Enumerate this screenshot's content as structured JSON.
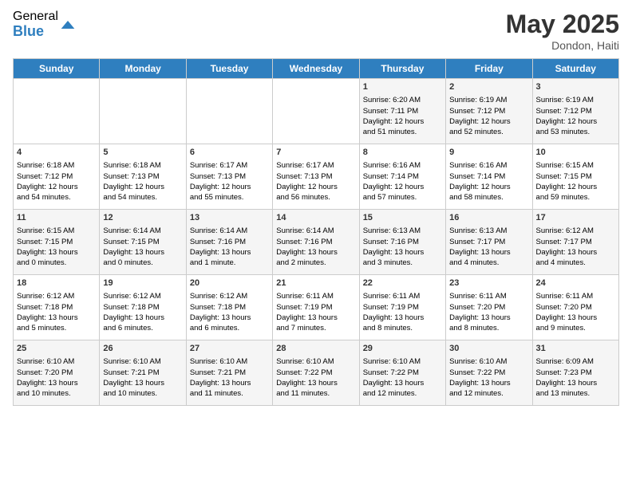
{
  "logo": {
    "general": "General",
    "blue": "Blue"
  },
  "title": "May 2025",
  "subtitle": "Dondon, Haiti",
  "days_header": [
    "Sunday",
    "Monday",
    "Tuesday",
    "Wednesday",
    "Thursday",
    "Friday",
    "Saturday"
  ],
  "weeks": [
    [
      {
        "day": "",
        "info": ""
      },
      {
        "day": "",
        "info": ""
      },
      {
        "day": "",
        "info": ""
      },
      {
        "day": "",
        "info": ""
      },
      {
        "day": "1",
        "info": "Sunrise: 6:20 AM\nSunset: 7:11 PM\nDaylight: 12 hours\nand 51 minutes."
      },
      {
        "day": "2",
        "info": "Sunrise: 6:19 AM\nSunset: 7:12 PM\nDaylight: 12 hours\nand 52 minutes."
      },
      {
        "day": "3",
        "info": "Sunrise: 6:19 AM\nSunset: 7:12 PM\nDaylight: 12 hours\nand 53 minutes."
      }
    ],
    [
      {
        "day": "4",
        "info": "Sunrise: 6:18 AM\nSunset: 7:12 PM\nDaylight: 12 hours\nand 54 minutes."
      },
      {
        "day": "5",
        "info": "Sunrise: 6:18 AM\nSunset: 7:13 PM\nDaylight: 12 hours\nand 54 minutes."
      },
      {
        "day": "6",
        "info": "Sunrise: 6:17 AM\nSunset: 7:13 PM\nDaylight: 12 hours\nand 55 minutes."
      },
      {
        "day": "7",
        "info": "Sunrise: 6:17 AM\nSunset: 7:13 PM\nDaylight: 12 hours\nand 56 minutes."
      },
      {
        "day": "8",
        "info": "Sunrise: 6:16 AM\nSunset: 7:14 PM\nDaylight: 12 hours\nand 57 minutes."
      },
      {
        "day": "9",
        "info": "Sunrise: 6:16 AM\nSunset: 7:14 PM\nDaylight: 12 hours\nand 58 minutes."
      },
      {
        "day": "10",
        "info": "Sunrise: 6:15 AM\nSunset: 7:15 PM\nDaylight: 12 hours\nand 59 minutes."
      }
    ],
    [
      {
        "day": "11",
        "info": "Sunrise: 6:15 AM\nSunset: 7:15 PM\nDaylight: 13 hours\nand 0 minutes."
      },
      {
        "day": "12",
        "info": "Sunrise: 6:14 AM\nSunset: 7:15 PM\nDaylight: 13 hours\nand 0 minutes."
      },
      {
        "day": "13",
        "info": "Sunrise: 6:14 AM\nSunset: 7:16 PM\nDaylight: 13 hours\nand 1 minute."
      },
      {
        "day": "14",
        "info": "Sunrise: 6:14 AM\nSunset: 7:16 PM\nDaylight: 13 hours\nand 2 minutes."
      },
      {
        "day": "15",
        "info": "Sunrise: 6:13 AM\nSunset: 7:16 PM\nDaylight: 13 hours\nand 3 minutes."
      },
      {
        "day": "16",
        "info": "Sunrise: 6:13 AM\nSunset: 7:17 PM\nDaylight: 13 hours\nand 4 minutes."
      },
      {
        "day": "17",
        "info": "Sunrise: 6:12 AM\nSunset: 7:17 PM\nDaylight: 13 hours\nand 4 minutes."
      }
    ],
    [
      {
        "day": "18",
        "info": "Sunrise: 6:12 AM\nSunset: 7:18 PM\nDaylight: 13 hours\nand 5 minutes."
      },
      {
        "day": "19",
        "info": "Sunrise: 6:12 AM\nSunset: 7:18 PM\nDaylight: 13 hours\nand 6 minutes."
      },
      {
        "day": "20",
        "info": "Sunrise: 6:12 AM\nSunset: 7:18 PM\nDaylight: 13 hours\nand 6 minutes."
      },
      {
        "day": "21",
        "info": "Sunrise: 6:11 AM\nSunset: 7:19 PM\nDaylight: 13 hours\nand 7 minutes."
      },
      {
        "day": "22",
        "info": "Sunrise: 6:11 AM\nSunset: 7:19 PM\nDaylight: 13 hours\nand 8 minutes."
      },
      {
        "day": "23",
        "info": "Sunrise: 6:11 AM\nSunset: 7:20 PM\nDaylight: 13 hours\nand 8 minutes."
      },
      {
        "day": "24",
        "info": "Sunrise: 6:11 AM\nSunset: 7:20 PM\nDaylight: 13 hours\nand 9 minutes."
      }
    ],
    [
      {
        "day": "25",
        "info": "Sunrise: 6:10 AM\nSunset: 7:20 PM\nDaylight: 13 hours\nand 10 minutes."
      },
      {
        "day": "26",
        "info": "Sunrise: 6:10 AM\nSunset: 7:21 PM\nDaylight: 13 hours\nand 10 minutes."
      },
      {
        "day": "27",
        "info": "Sunrise: 6:10 AM\nSunset: 7:21 PM\nDaylight: 13 hours\nand 11 minutes."
      },
      {
        "day": "28",
        "info": "Sunrise: 6:10 AM\nSunset: 7:22 PM\nDaylight: 13 hours\nand 11 minutes."
      },
      {
        "day": "29",
        "info": "Sunrise: 6:10 AM\nSunset: 7:22 PM\nDaylight: 13 hours\nand 12 minutes."
      },
      {
        "day": "30",
        "info": "Sunrise: 6:10 AM\nSunset: 7:22 PM\nDaylight: 13 hours\nand 12 minutes."
      },
      {
        "day": "31",
        "info": "Sunrise: 6:09 AM\nSunset: 7:23 PM\nDaylight: 13 hours\nand 13 minutes."
      }
    ]
  ]
}
